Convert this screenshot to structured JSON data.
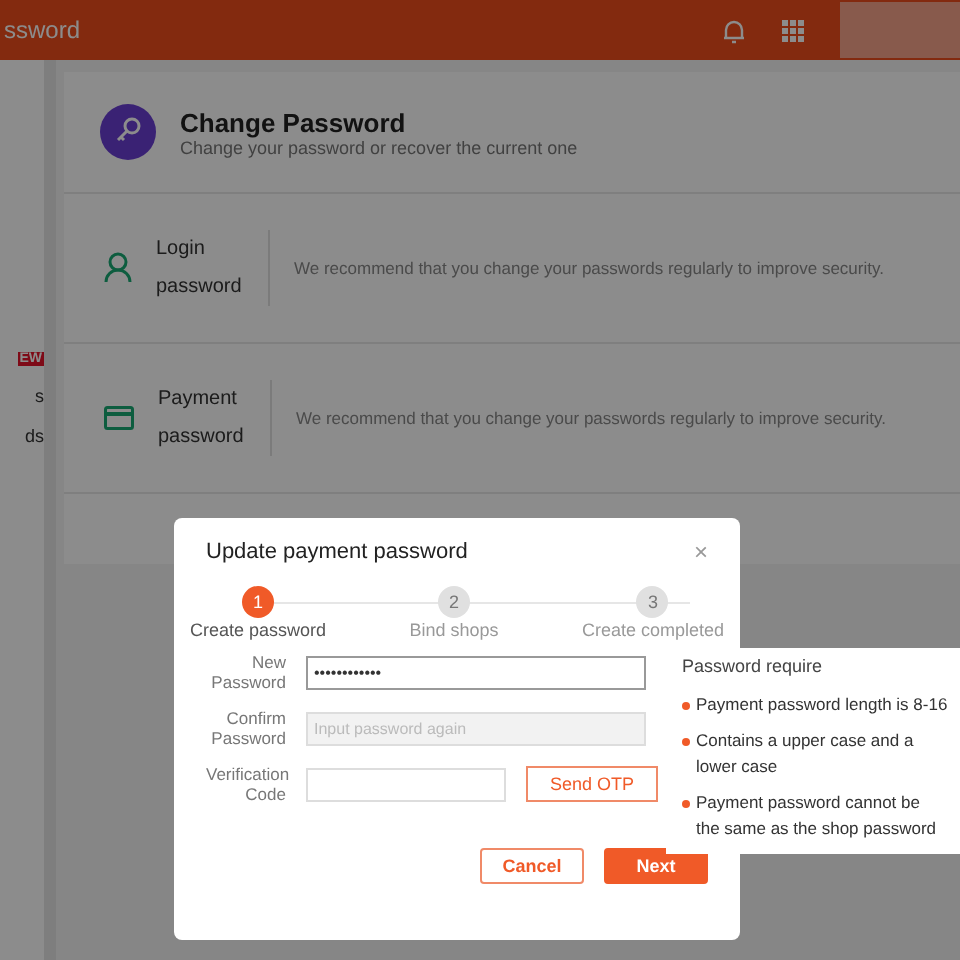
{
  "header": {
    "title": "ssword"
  },
  "sidebar": {
    "badge": "EW",
    "items": [
      {
        "label": "s"
      },
      {
        "label": "ds"
      }
    ]
  },
  "page": {
    "title": "Change Password",
    "subtitle": "Change your password or recover the current one",
    "options": [
      {
        "kind": "login",
        "name": "Login password",
        "description": "We recommend that you change your passwords regularly to improve security."
      },
      {
        "kind": "payment",
        "name": "Payment password",
        "description": "We recommend that you change your passwords regularly to improve security."
      }
    ]
  },
  "modal": {
    "title": "Update payment password",
    "close": "×",
    "steps": [
      {
        "number": "1",
        "label": "Create password",
        "selected": true
      },
      {
        "number": "2",
        "label": "Bind shops",
        "selected": false
      },
      {
        "number": "3",
        "label": "Create completed",
        "selected": false
      }
    ],
    "fields": [
      {
        "label": "New Password",
        "value": "••••••••••••",
        "focused": true,
        "disabled": false
      },
      {
        "label": "Confirm Password",
        "placeholder": "Input password again",
        "focused": false,
        "disabled": true
      },
      {
        "label": "Verification Code",
        "focused": false,
        "disabled": false,
        "action": "Send OTP"
      }
    ],
    "buttons": [
      {
        "kind": "secondary",
        "label": "Cancel"
      },
      {
        "kind": "primary",
        "label": "Next"
      }
    ]
  },
  "tooltip": {
    "title": "Password require",
    "items": [
      "Payment password length is 8-16",
      "Contains a upper case and a lower case",
      "Payment password cannot be the same as the shop password"
    ]
  }
}
